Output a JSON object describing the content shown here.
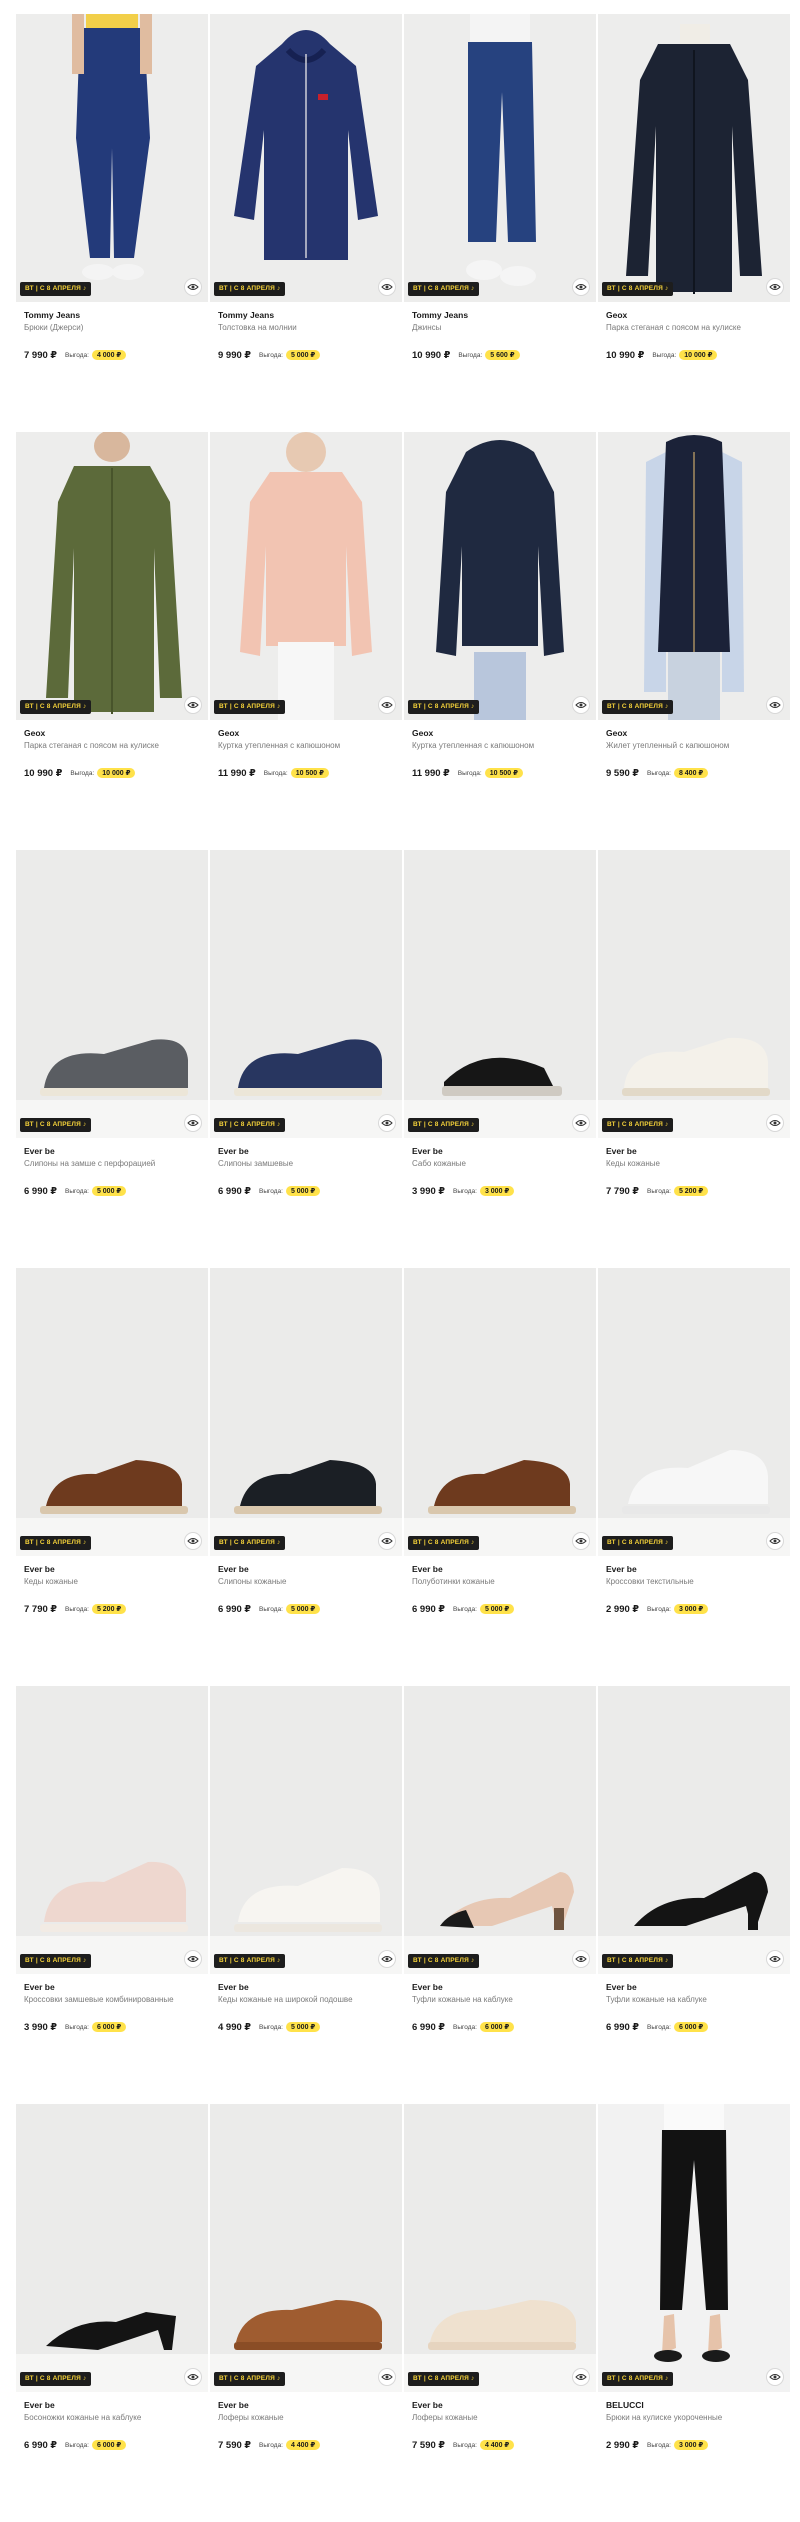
{
  "ui": {
    "promo_label": "ВТ | С 8 АПРЕЛЯ ♪",
    "save_label": "Выгода:"
  },
  "products": [
    {
      "brand": "Tommy Jeans",
      "title": "Брюки (Джерси)",
      "price": "7 990 ₽",
      "save": "4 000 ₽",
      "kind": "pants"
    },
    {
      "brand": "Tommy Jeans",
      "title": "Толстовка на молнии",
      "price": "9 990 ₽",
      "save": "5 000 ₽",
      "kind": "hoodie"
    },
    {
      "brand": "Tommy Jeans",
      "title": "Джинсы",
      "price": "10 990 ₽",
      "save": "5 600 ₽",
      "kind": "jeans"
    },
    {
      "brand": "Geox",
      "title": "Парка стеганая с поясом на кулиске",
      "price": "10 990 ₽",
      "save": "10 000 ₽",
      "kind": "parka-navy"
    },
    {
      "brand": "Geox",
      "title": "Парка стеганая с поясом на кулиске",
      "price": "10 990 ₽",
      "save": "10 000 ₽",
      "kind": "parka-olive"
    },
    {
      "brand": "Geox",
      "title": "Куртка утепленная с капюшоном",
      "price": "11 990 ₽",
      "save": "10 500 ₽",
      "kind": "jacket-pink"
    },
    {
      "brand": "Geox",
      "title": "Куртка утепленная с капюшоном",
      "price": "11 990 ₽",
      "save": "10 500 ₽",
      "kind": "jacket-navy"
    },
    {
      "brand": "Geox",
      "title": "Жилет утепленный с капюшоном",
      "price": "9 590 ₽",
      "save": "8 400 ₽",
      "kind": "vest"
    },
    {
      "brand": "Ever be",
      "title": "Слипоны на замше с перфорацией",
      "price": "6 990 ₽",
      "save": "5 000 ₽",
      "kind": "slipon-grey"
    },
    {
      "brand": "Ever be",
      "title": "Слипоны замшевые",
      "price": "6 990 ₽",
      "save": "5 000 ₽",
      "kind": "slipon-navy"
    },
    {
      "brand": "Ever be",
      "title": "Сабо кожаные",
      "price": "3 990 ₽",
      "save": "3 000 ₽",
      "kind": "sandal"
    },
    {
      "brand": "Ever be",
      "title": "Кеды кожаные",
      "price": "7 790 ₽",
      "save": "5 200 ₽",
      "kind": "sneaker-white"
    },
    {
      "brand": "Ever be",
      "title": "Кеды кожаные",
      "price": "7 790 ₽",
      "save": "5 200 ₽",
      "kind": "derby-brown"
    },
    {
      "brand": "Ever be",
      "title": "Слипоны кожаные",
      "price": "6 990 ₽",
      "save": "5 000 ₽",
      "kind": "derby-black"
    },
    {
      "brand": "Ever be",
      "title": "Полуботинки кожаные",
      "price": "6 990 ₽",
      "save": "5 000 ₽",
      "kind": "derby-brown"
    },
    {
      "brand": "Ever be",
      "title": "Кроссовки текстильные",
      "price": "2 990 ₽",
      "save": "3 000 ₽",
      "kind": "runner-white"
    },
    {
      "brand": "Ever be",
      "title": "Кроссовки замшевые комбинированные",
      "price": "3 990 ₽",
      "save": "6 000 ₽",
      "kind": "sneaker-pink"
    },
    {
      "brand": "Ever be",
      "title": "Кеды кожаные на широкой подошве",
      "price": "4 990 ₽",
      "save": "5 000 ₽",
      "kind": "sneaker-white2"
    },
    {
      "brand": "Ever be",
      "title": "Туфли кожаные на каблуке",
      "price": "6 990 ₽",
      "save": "6 000 ₽",
      "kind": "pump-beige"
    },
    {
      "brand": "Ever be",
      "title": "Туфли кожаные на каблуке",
      "price": "6 990 ₽",
      "save": "6 000 ₽",
      "kind": "pump-black"
    },
    {
      "brand": "Ever be",
      "title": "Босоножки кожаные на каблуке",
      "price": "6 990 ₽",
      "save": "6 000 ₽",
      "kind": "slingback"
    },
    {
      "brand": "Ever be",
      "title": "Лоферы кожаные",
      "price": "7 590 ₽",
      "save": "4 400 ₽",
      "kind": "loafer-tan"
    },
    {
      "brand": "Ever be",
      "title": "Лоферы кожаные",
      "price": "7 590 ₽",
      "save": "4 400 ₽",
      "kind": "loafer-cream"
    },
    {
      "brand": "BELUCCI",
      "title": "Брюки на кулиске укороченные",
      "price": "2 990 ₽",
      "save": "3 000 ₽",
      "kind": "trousers"
    }
  ]
}
